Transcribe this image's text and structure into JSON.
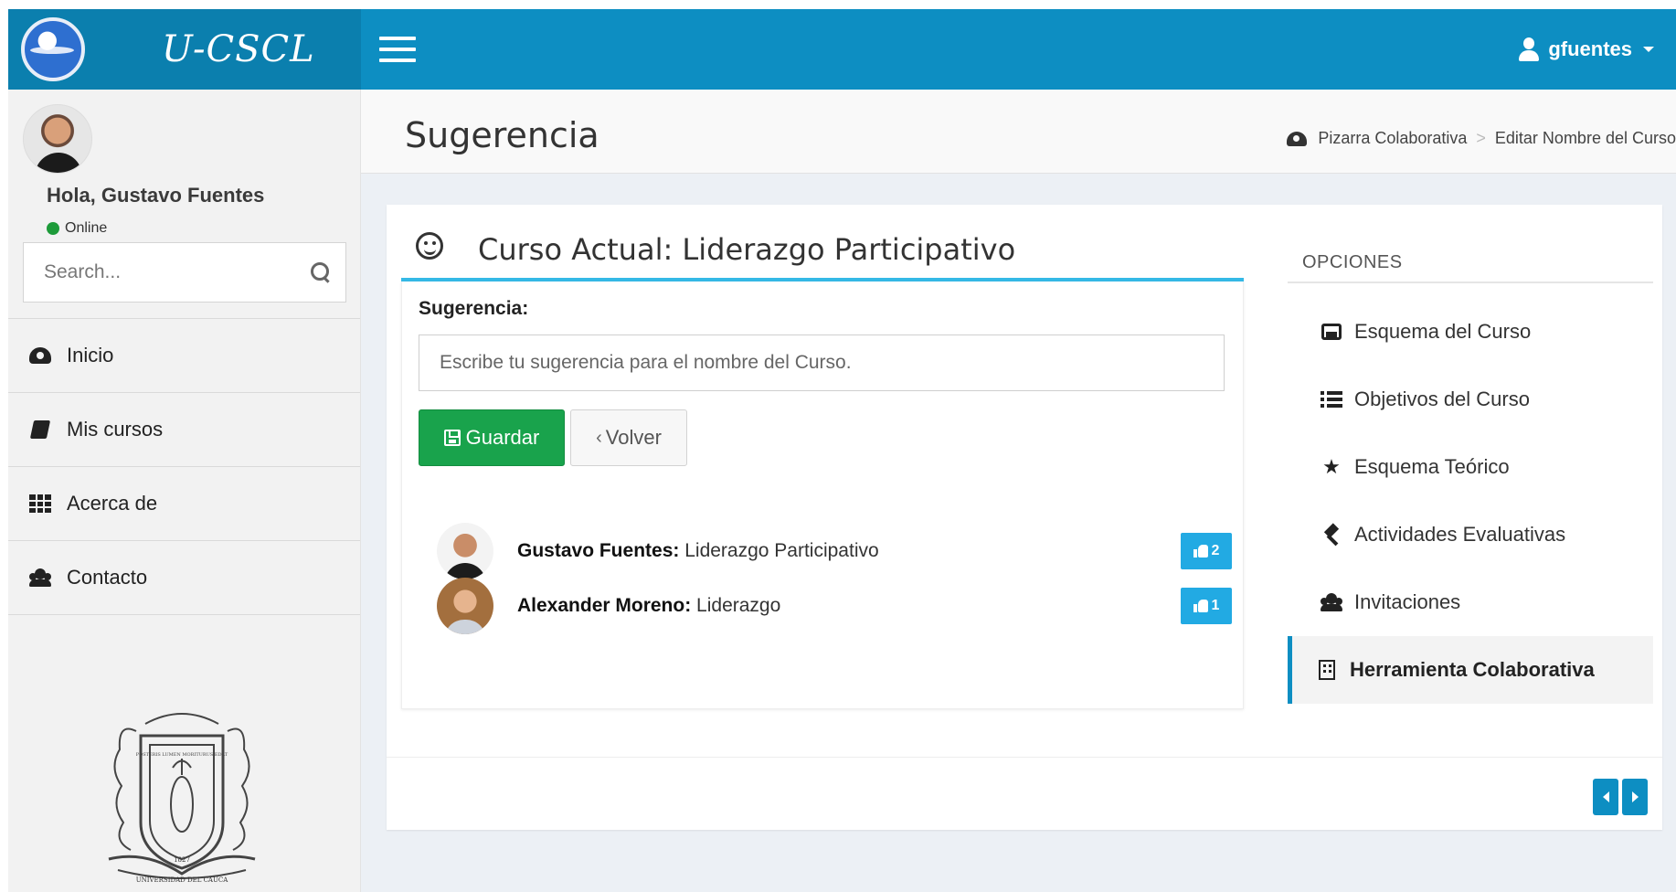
{
  "app": {
    "logo_text": "U-CSCL",
    "user_menu_label": "gfuentes"
  },
  "sidebar": {
    "greeting": "Hola, Gustavo Fuentes",
    "status": "Online",
    "search_placeholder": "Search...",
    "menu": [
      {
        "label": "Inicio",
        "icon": "dashboard-icon"
      },
      {
        "label": "Mis cursos",
        "icon": "book-icon"
      },
      {
        "label": "Acerca de",
        "icon": "grid-icon"
      },
      {
        "label": "Contacto",
        "icon": "users-icon"
      }
    ],
    "crest_label": "UNIVERSIDAD DEL CAUCA",
    "crest_year": "1827",
    "crest_motto": "POSTERIS LUMEN MORITURUS EDAT"
  },
  "header": {
    "page_title": "Sugerencia",
    "breadcrumb": [
      "Pizarra Colaborativa",
      "Editar Nombre del Curso"
    ]
  },
  "panel": {
    "title": "Curso Actual: Liderazgo Participativo",
    "field_label": "Sugerencia:",
    "field_placeholder": "Escribe tu sugerencia para el nombre del Curso.",
    "save_label": "Guardar",
    "back_label": "Volver",
    "suggestions": [
      {
        "author": "Gustavo Fuentes:",
        "text": "Liderazgo Participativo",
        "votes": "2"
      },
      {
        "author": "Alexander Moreno:",
        "text": "Liderazgo",
        "votes": "1"
      }
    ]
  },
  "options": {
    "title": "OPCIONES",
    "items": [
      {
        "label": "Esquema del Curso",
        "icon": "inbox-icon"
      },
      {
        "label": "Objetivos del Curso",
        "icon": "list-icon"
      },
      {
        "label": "Esquema Teórico",
        "icon": "star-icon"
      },
      {
        "label": "Actividades Evaluativas",
        "icon": "gavel-icon"
      },
      {
        "label": "Invitaciones",
        "icon": "users-icon"
      },
      {
        "label": "Herramienta Colaborativa",
        "icon": "building-icon",
        "active": true
      }
    ]
  },
  "colors": {
    "topbar": "#0d8ec2",
    "accent": "#35b9e6",
    "save_button": "#19a34c",
    "vote_badge": "#22aae3"
  }
}
